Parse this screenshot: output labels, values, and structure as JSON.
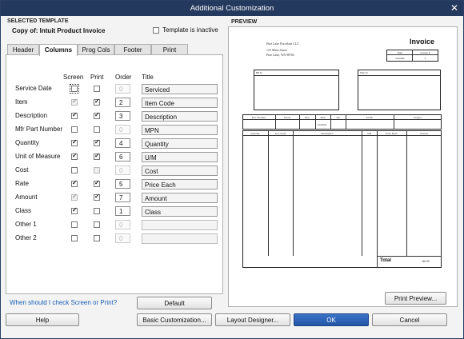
{
  "window": {
    "title": "Additional Customization",
    "close_glyph": "✕"
  },
  "template": {
    "section_label": "SELECTED TEMPLATE",
    "name": "Copy of: Intuit Product Invoice",
    "inactive_label": "Template is inactive"
  },
  "tabs": [
    {
      "label": "Header",
      "active": false
    },
    {
      "label": "Columns",
      "active": true
    },
    {
      "label": "Prog Cols",
      "active": false
    },
    {
      "label": "Footer",
      "active": false
    },
    {
      "label": "Print",
      "active": false
    }
  ],
  "columns": {
    "headers": {
      "screen": "Screen",
      "print": "Print",
      "order": "Order",
      "title": "Title"
    },
    "rows": [
      {
        "label": "Service Date",
        "screen": false,
        "print": false,
        "order": "0",
        "title": "Serviced",
        "screen_focus": true
      },
      {
        "label": "Item",
        "screen": true,
        "screen_disabled": true,
        "print": true,
        "order": "2",
        "title": "Item Code"
      },
      {
        "label": "Description",
        "screen": true,
        "print": true,
        "order": "3",
        "title": "Description"
      },
      {
        "label": "Mfr Part Number",
        "screen": false,
        "print": false,
        "order": "0",
        "title": "MPN"
      },
      {
        "label": "Quantity",
        "screen": true,
        "print": true,
        "order": "4",
        "title": "Quantity"
      },
      {
        "label": "Unit of Measure",
        "screen": true,
        "print": true,
        "order": "6",
        "title": "U/M"
      },
      {
        "label": "Cost",
        "screen": false,
        "print": false,
        "print_disabled": true,
        "order": "0",
        "title": "Cost"
      },
      {
        "label": "Rate",
        "screen": true,
        "print": true,
        "order": "5",
        "title": "Price Each"
      },
      {
        "label": "Amount",
        "screen": true,
        "screen_disabled": true,
        "print": true,
        "order": "7",
        "title": "Amount"
      },
      {
        "label": "Class",
        "screen": true,
        "print": false,
        "order": "1",
        "title": "Class"
      },
      {
        "label": "Other 1",
        "screen": false,
        "print": false,
        "order": "0",
        "title": ""
      },
      {
        "label": "Other 2",
        "screen": false,
        "print": false,
        "order": "0",
        "title": ""
      }
    ]
  },
  "help_link": "When should I check Screen or Print?",
  "buttons": {
    "default": "Default",
    "print_preview": "Print Preview...",
    "help": "Help",
    "basic": "Basic Customization...",
    "layout": "Layout Designer...",
    "ok": "OK",
    "cancel": "Cancel"
  },
  "preview": {
    "label": "PREVIEW",
    "company": "Pine Lake Porcelain LLC",
    "address1": "123 Main Street",
    "address2": "Pine Lake, WA 98765",
    "doc_title": "Invoice",
    "date_header": "Date",
    "invoice_no_header": "Invoice #",
    "date_value": "1/1/2021",
    "invoice_no_value": "2",
    "bill_to": "Bill To",
    "ship_to": "Ship To",
    "meta_headers": [
      "P.O. Number",
      "Terms",
      "Rep",
      "Ship",
      "Via",
      "F.O.B.",
      "Project"
    ],
    "ship_value": "1/1/2021",
    "line_headers": [
      "Quantity",
      "Item Code",
      "Description",
      "U/M",
      "Price Each",
      "Amount"
    ],
    "total_label": "Total",
    "total_value": "$0.00"
  }
}
